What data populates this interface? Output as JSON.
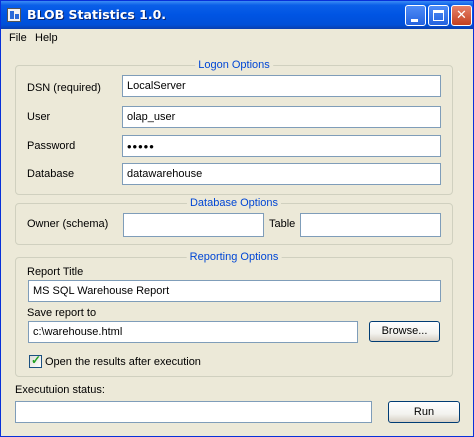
{
  "window": {
    "title": "BLOB Statistics 1.0."
  },
  "menu": {
    "file": "File",
    "help": "Help"
  },
  "logon": {
    "legend": "Logon Options",
    "dsn_label": "DSN (required)",
    "dsn_value": "LocalServer",
    "user_label": "User",
    "user_value": "olap_user",
    "password_label": "Password",
    "password_value": "•••••",
    "database_label": "Database",
    "database_value": "datawarehouse"
  },
  "database": {
    "legend": "Database Options",
    "owner_label": "Owner (schema)",
    "owner_value": "",
    "table_label": "Table",
    "table_value": ""
  },
  "reporting": {
    "legend": "Reporting Options",
    "title_label": "Report Title",
    "title_value": "MS SQL Warehouse Report",
    "save_label": "Save report to",
    "save_value": "c:\\warehouse.html",
    "browse_label": "Browse...",
    "open_results_label": "Open the results after execution",
    "open_results_checked": true
  },
  "status": {
    "label": "Executuion status:",
    "value": "",
    "run_label": "Run"
  }
}
